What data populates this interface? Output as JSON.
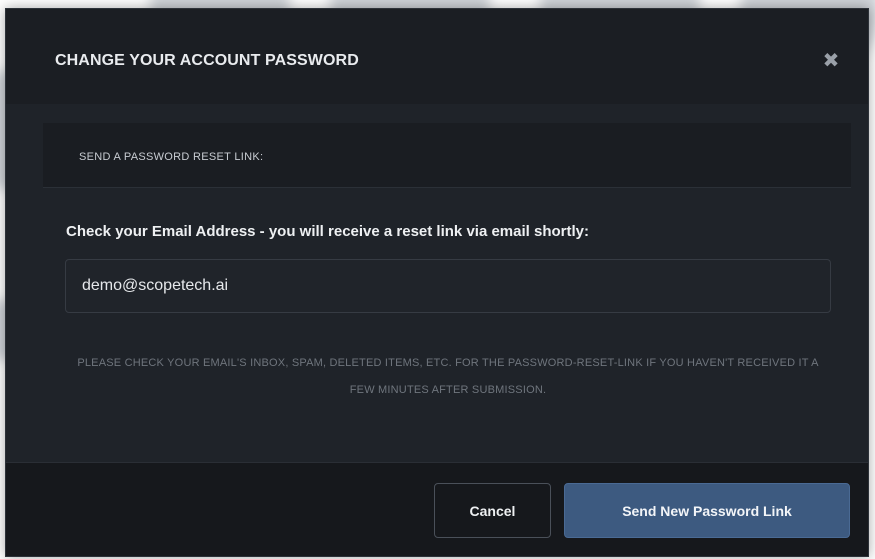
{
  "modal": {
    "title": "CHANGE YOUR ACCOUNT PASSWORD",
    "close_glyph": "✖",
    "section_label": "SEND A PASSWORD RESET LINK:",
    "instruction": "Check your Email Address - you will receive a reset link via email shortly:",
    "email_value": "demo@scopetech.ai",
    "help_text": "PLEASE CHECK YOUR EMAIL'S INBOX, SPAM, DELETED ITEMS, ETC. FOR THE PASSWORD-RESET-LINK IF YOU HAVEN'T RECEIVED IT A FEW MINUTES AFTER SUBMISSION.",
    "cancel_label": "Cancel",
    "send_label": "Send New Password Link"
  },
  "colors": {
    "modal_bg": "#1f2329",
    "primary_button": "#3d5a80",
    "footer_bg": "#16181c"
  },
  "icons": {
    "close": "close-icon"
  }
}
